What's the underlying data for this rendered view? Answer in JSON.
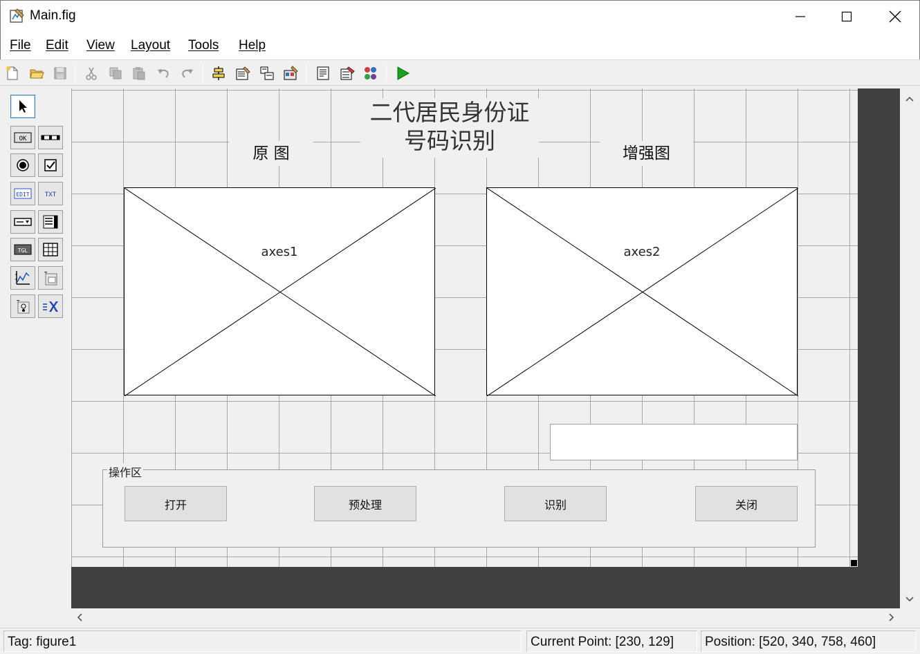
{
  "window": {
    "title": "Main.fig"
  },
  "menu": {
    "items": [
      "File",
      "Edit",
      "View",
      "Layout",
      "Tools",
      "Help"
    ]
  },
  "toolbar": {
    "buttons": [
      "new-icon",
      "open-icon",
      "save-icon",
      "cut-icon",
      "copy-icon",
      "paste-icon",
      "undo-icon",
      "redo-icon",
      "align-icon",
      "menu-editor-icon",
      "tab-order-icon",
      "toolbar-editor-icon",
      "editor-icon",
      "property-inspector-icon",
      "object-browser-icon",
      "run-icon"
    ],
    "run_color": "#1aa01a"
  },
  "palette": {
    "tools": [
      "select",
      "push-button",
      "slider",
      "radio-button",
      "check-box",
      "edit-text",
      "static-text",
      "pop-up-menu",
      "list-box",
      "toggle-button",
      "table",
      "axes",
      "panel",
      "button-group",
      "activex-control"
    ],
    "glyphs": {
      "push": "OK",
      "edit": "EDIT",
      "static": "TXT",
      "toggle": "TGL"
    }
  },
  "figure": {
    "title_line1": "二代居民身份证",
    "title_line2": "号码识别",
    "left_label": "原 图",
    "right_label": "增强图",
    "axes1": "axes1",
    "axes2": "axes2",
    "panel_title": "操作区",
    "buttons": [
      "打开",
      "预处理",
      "识别",
      "关闭"
    ]
  },
  "status": {
    "tag": "Tag: figure1",
    "current_point": "Current Point:  [230, 129]",
    "position": "Position: [520, 340, 758, 460]"
  }
}
